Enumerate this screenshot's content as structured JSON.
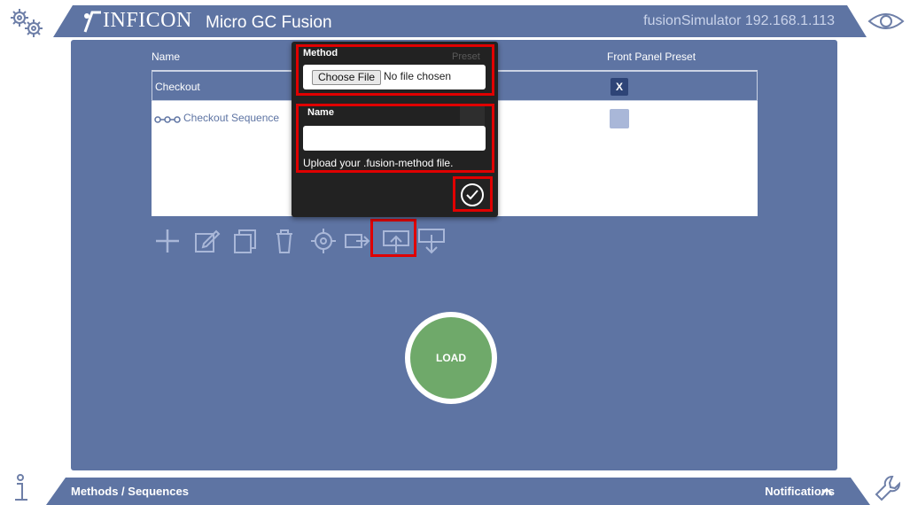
{
  "header": {
    "brand": "INFICON",
    "product": "Micro GC Fusion",
    "host": "fusionSimulator 192.168.1.113"
  },
  "icons": {
    "settings": "gears-icon",
    "view": "eye-icon",
    "info": "info-icon",
    "tools": "wrench-icon"
  },
  "table": {
    "columns": {
      "name": "Name",
      "preset": "Preset",
      "front_panel_preset": "Front Panel Preset"
    },
    "rows": [
      {
        "name": "Checkout",
        "selected": true,
        "front_panel_mark": "X"
      },
      {
        "name": "Checkout Sequence",
        "selected": false,
        "front_panel_mark": ""
      }
    ]
  },
  "toolbar": {
    "actions": [
      "add-icon",
      "edit-icon",
      "copy-icon",
      "delete-icon",
      "target-icon",
      "export-icon",
      "upload-icon",
      "download-icon"
    ]
  },
  "dialog": {
    "method_label": "Method",
    "choose_file_label": "Choose File",
    "no_file_text": "No file chosen",
    "name_label": "Name",
    "name_value": "",
    "hint": "Upload your .fusion-method file."
  },
  "load_button": {
    "label": "LOAD"
  },
  "footer": {
    "left_label": "Methods / Sequences",
    "right_label": "Notifications"
  },
  "colors": {
    "panel": "#5e74a3",
    "dialog": "#222222",
    "highlight": "#e00000",
    "load": "#6fa96a"
  }
}
